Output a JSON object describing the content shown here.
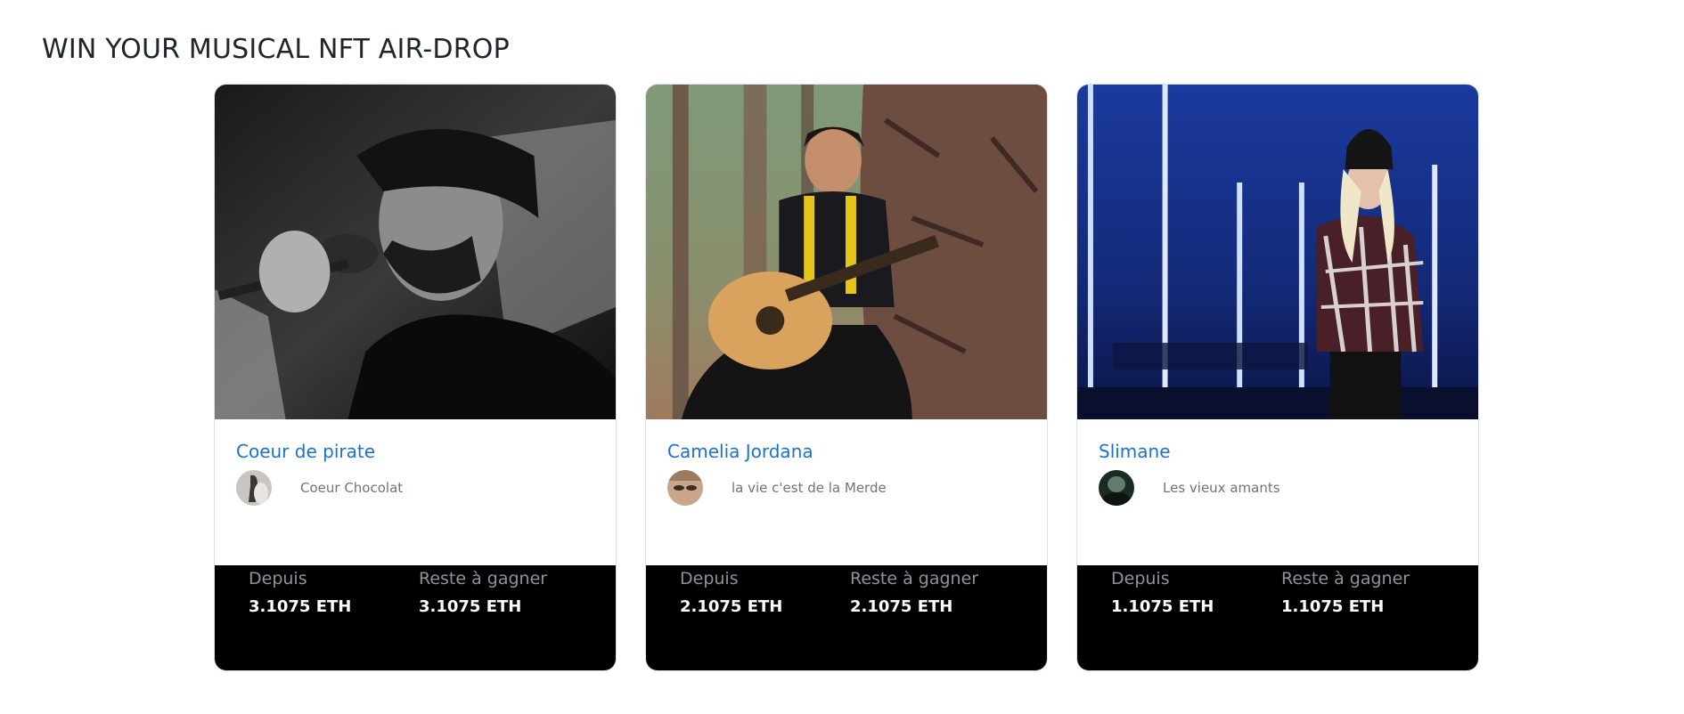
{
  "section": {
    "title": "WIN YOUR MUSICAL NFT AIR-DROP"
  },
  "cards": [
    {
      "artist": "Coeur de pirate",
      "song": "Coeur Chocolat",
      "image_icon": "singer-bw-photo",
      "avatar_icon": "song-cover-avatar",
      "depuis_label": "Depuis",
      "depuis_value": "3.1075 ETH",
      "reste_label": "Reste à gagner",
      "reste_value": "3.1075 ETH"
    },
    {
      "artist": "Camelia Jordana",
      "song": "la vie c'est de la Merde",
      "image_icon": "guitarist-forest-photo",
      "avatar_icon": "song-cover-avatar",
      "depuis_label": "Depuis",
      "depuis_value": "2.1075 ETH",
      "reste_label": "Reste à gagner",
      "reste_value": "2.1075 ETH"
    },
    {
      "artist": "Slimane",
      "song": "Les vieux amants",
      "image_icon": "stage-singer-photo",
      "avatar_icon": "song-cover-avatar",
      "depuis_label": "Depuis",
      "depuis_value": "1.1075 ETH",
      "reste_label": "Reste à gagner",
      "reste_value": "1.1075 ETH"
    }
  ],
  "colors": {
    "link": "#1a73c9",
    "footer_bg": "#000000",
    "muted": "#6c757d"
  }
}
